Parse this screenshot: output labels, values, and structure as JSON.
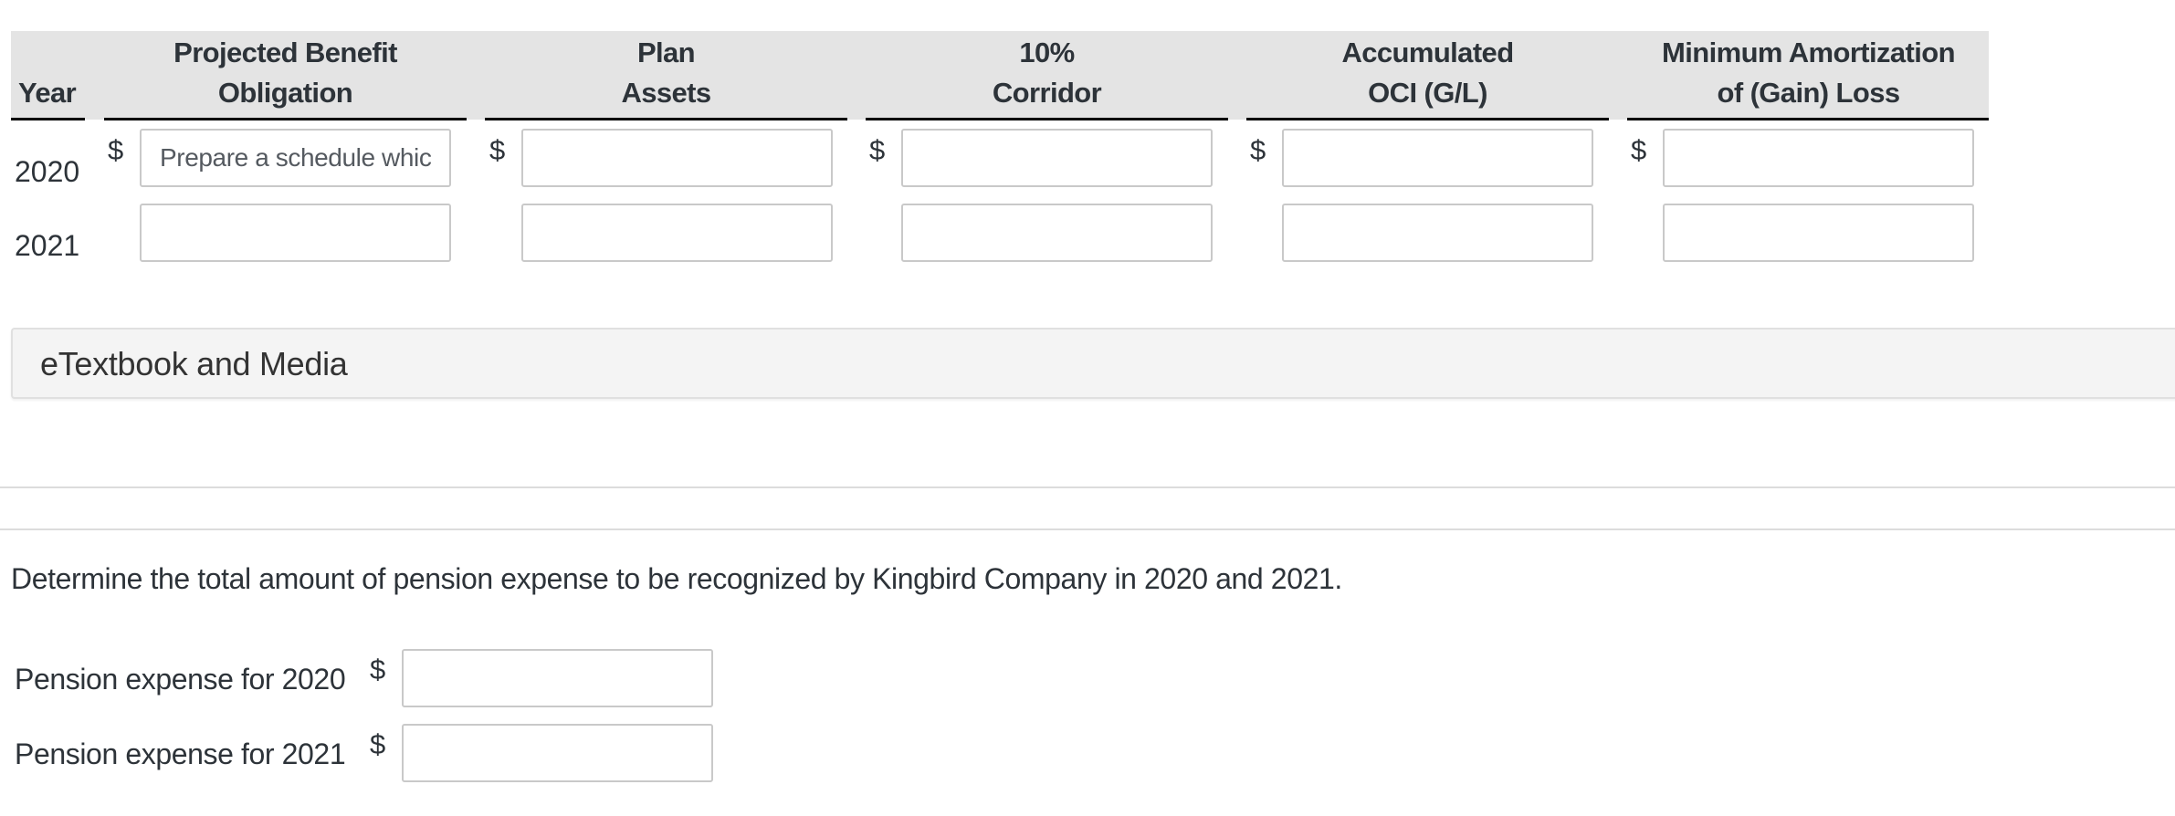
{
  "table": {
    "year_header": "Year",
    "columns": [
      {
        "line1": "Projected Benefit",
        "line2": "Obligation"
      },
      {
        "line1": "Plan",
        "line2": "Assets"
      },
      {
        "line1": "10%",
        "line2": "Corridor"
      },
      {
        "line1": "Accumulated",
        "line2": "OCI (G/L)"
      },
      {
        "line1": "Minimum Amortization",
        "line2": "of (Gain) Loss"
      }
    ],
    "currency_symbol": "$",
    "rows": [
      {
        "year": "2020",
        "values": [
          "Prepare a schedule whicl",
          "",
          "",
          "",
          ""
        ]
      },
      {
        "year": "2021",
        "values": [
          "",
          "",
          "",
          "",
          ""
        ]
      }
    ]
  },
  "etextbook": {
    "label": "eTextbook and Media"
  },
  "question": {
    "text": "Determine the total amount of pension expense to be recognized by Kingbird Company in 2020 and 2021."
  },
  "pension_expense": {
    "currency_symbol": "$",
    "items": [
      {
        "label": "Pension expense for 2020",
        "value": ""
      },
      {
        "label": "Pension expense for 2021",
        "value": ""
      }
    ]
  }
}
